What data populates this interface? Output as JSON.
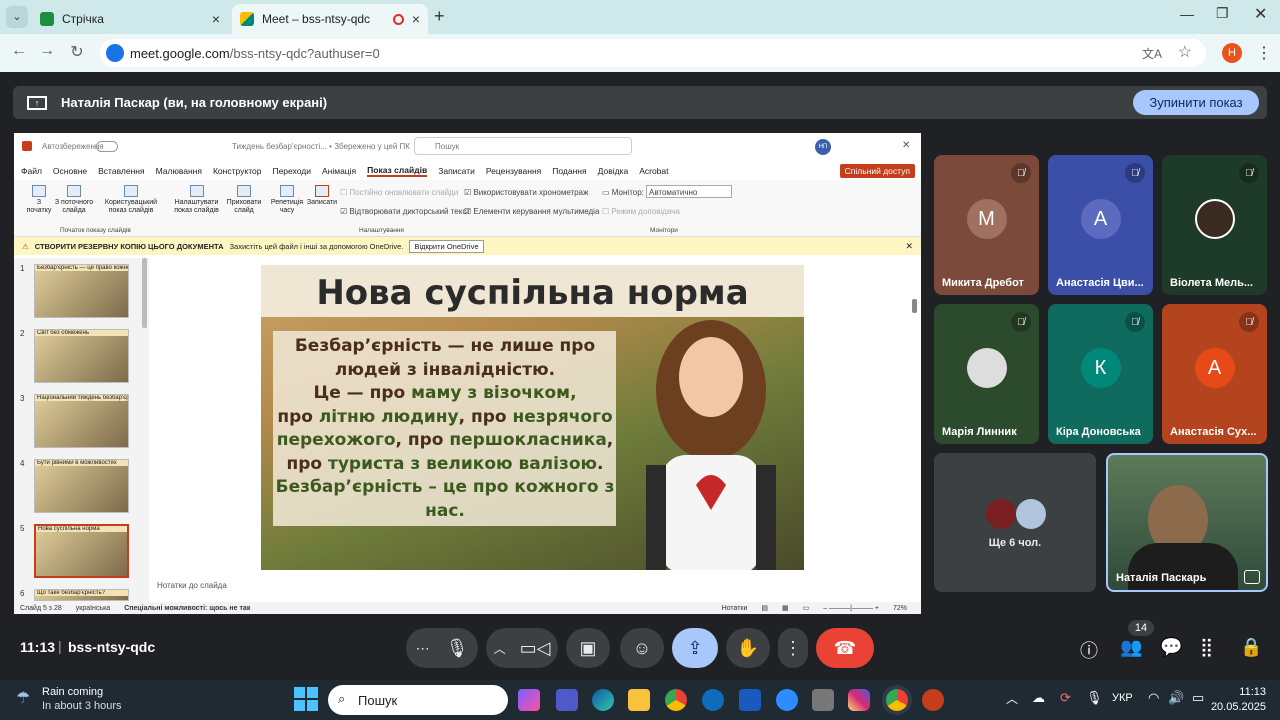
{
  "browser": {
    "tabs": [
      {
        "label": "Стрічка",
        "icon": "google-classroom-icon",
        "color": "#1e8e3e"
      },
      {
        "label": "Meet – bss-ntsy-qdc",
        "icon": "google-meet-icon",
        "color": "#00897b"
      }
    ],
    "url_host": "meet.google.com",
    "url_path": "/bss-ntsy-qdc?authuser=0",
    "profile_initial": "Н"
  },
  "banner": {
    "text": "Наталія Паскар (ви, на головному екрані)",
    "stop_label": "Зупинити показ"
  },
  "ppt": {
    "titlebar": {
      "autosave": "Автозбереження",
      "doc": "Тиждень безбар'єрності...  •  Збережено у цей ПК",
      "search": "Пошук",
      "user": "НП"
    },
    "menus": [
      "Файл",
      "Основне",
      "Вставлення",
      "Малювання",
      "Конструктор",
      "Переходи",
      "Анімація",
      "Показ слайдів",
      "Записати",
      "Рецензування",
      "Подання",
      "Довідка",
      "Acrobat"
    ],
    "active_menu": "Показ слайдів",
    "share": "Спільний доступ",
    "ribbon": {
      "from_start": "З початку",
      "from_current": "З поточного слайда",
      "custom": "Користувацький показ слайдів",
      "setup": "Налаштувати показ слайдів",
      "hide": "Приховати слайд",
      "rehearse": "Репетиція часу",
      "record": "Записати",
      "group1": "Початок показу слайдів",
      "group2": "Налаштування",
      "group3": "Монітори",
      "opt1": "Постійно оновлювати слайди",
      "opt2": "Відтворювати дикторський текст",
      "opt3": "Використовувати хронометраж",
      "opt4": "Елементи керування мультимедіа",
      "monitor_label": "Монітор:",
      "monitor_value": "Автоматично",
      "presenter": "Режим доповідача"
    },
    "infobar": {
      "title": "СТВОРИТИ РЕЗЕРВНУ КОПІЮ ЦЬОГО ДОКУМЕНТА",
      "text": "Захистіть цей файл і інші за допомогою OneDrive.",
      "button": "Відкрити OneDrive"
    },
    "thumbnails": [
      {
        "num": "1",
        "title": "Безбар'єрність — це право кожного"
      },
      {
        "num": "2",
        "title": "Світ без обмежень"
      },
      {
        "num": "3",
        "title": "Національний тиждень безбар'єрності"
      },
      {
        "num": "4",
        "title": "Бути рівними в можливостях"
      },
      {
        "num": "5",
        "title": "Нова суспільна норма"
      },
      {
        "num": "6",
        "title": "Що таке безбар'єрність?"
      }
    ],
    "slide": {
      "title": "Нова суспільна норма",
      "line1": "Безбар’єрність — не лише про людей з інвалідністю.",
      "line2a": "Це — про ",
      "line2b": "маму з візочком,",
      "line3a": "про ",
      "line3b": "літню людину",
      "line3c": ", про ",
      "line3d": "незрячого перехожого",
      "line3e": ", про ",
      "line3f": "першокласника",
      "line3g": ",",
      "line4a": "про ",
      "line4b": "туриста з великою валізою",
      "line4c": ".",
      "line5": "Безбар’єрність – це про кожного з нас."
    },
    "notes": "Нотатки до слайда",
    "status": {
      "slide": "Слайд 5 з 28",
      "lang": "українська",
      "access": "Спеціальні можливості: щось не так",
      "notes_btn": "Нотатки",
      "zoom": "72%"
    }
  },
  "participants": [
    {
      "name": "Микита Дребот",
      "initial": "М",
      "bg": "#7b4a3a",
      "avatar": "#a07060"
    },
    {
      "name": "Анастасія Цви...",
      "initial": "А",
      "bg": "#3b4fa8",
      "avatar": "#5c6bc0"
    },
    {
      "name": "Віолета Мель...",
      "initial": "",
      "bg": "#1e3b2a",
      "avatar": "#3b2a20"
    },
    {
      "name": "Марія Линник",
      "initial": "",
      "bg": "#2c4a2c",
      "avatar": "#ddd"
    },
    {
      "name": "Кіра Доновська",
      "initial": "К",
      "bg": "#0f6b5e",
      "avatar": "#00897b"
    },
    {
      "name": "Анастасія Сух...",
      "initial": "А",
      "bg": "#b3441e",
      "avatar": "#e64a19"
    }
  ],
  "others": "Ще 6 чол.",
  "self": {
    "name": "Наталія Паскарь"
  },
  "meeting": {
    "time": "11:13",
    "code": "bss-ntsy-qdc",
    "people_count": "14"
  },
  "taskbar": {
    "weather_title": "Rain coming",
    "weather_sub": "In about 3 hours",
    "search": "Пошук",
    "lang": "УКР",
    "time": "11:13",
    "date": "20.05.2025"
  }
}
